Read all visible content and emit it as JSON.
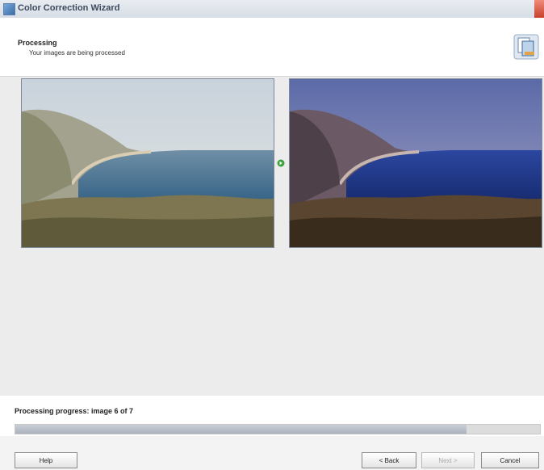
{
  "window": {
    "title": "Color Correction Wizard"
  },
  "header": {
    "title": "Processing",
    "subtitle": "Your images are being processed"
  },
  "main": {
    "images": [
      {
        "label": "",
        "role": "original"
      },
      {
        "label": "",
        "role": "corrected"
      }
    ],
    "progress": {
      "text": "Processing progress: image 6 of 7",
      "fraction": 0.86
    }
  },
  "footer": {
    "help_label": "Help",
    "back_label": "< Back",
    "next_label": "Next >",
    "cancel_label": "Cancel"
  },
  "colors": {
    "accent": "#3a6da8",
    "arrow": "#3fa23f"
  }
}
